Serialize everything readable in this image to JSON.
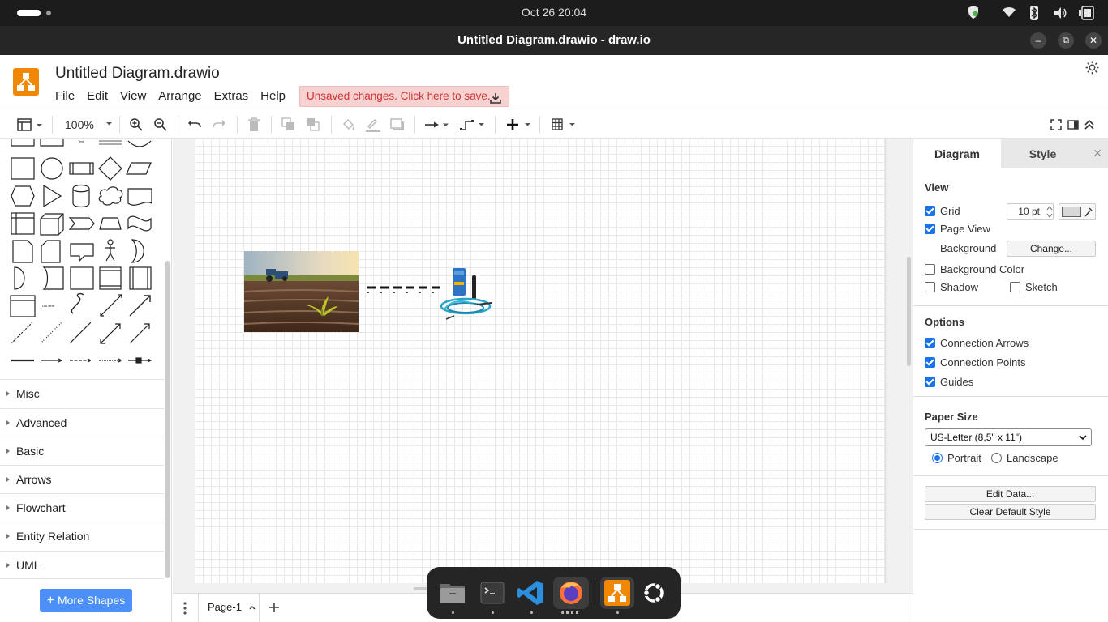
{
  "system": {
    "clock": "Oct 26  20:04"
  },
  "window": {
    "title": "Untitled Diagram.drawio - draw.io",
    "minimize": "–",
    "maximize": "⧉",
    "close": "✕"
  },
  "app": {
    "doc_title": "Untitled Diagram.drawio",
    "menu": [
      "File",
      "Edit",
      "View",
      "Arrange",
      "Extras",
      "Help"
    ],
    "unsaved_notice": "Unsaved changes. Click here to save."
  },
  "toolbar": {
    "zoom": "100%"
  },
  "sidebar": {
    "categories": [
      "Misc",
      "Advanced",
      "Basic",
      "Arrows",
      "Flowchart",
      "Entity Relation",
      "UML"
    ],
    "more_shapes": "More Shapes"
  },
  "page_tabs": {
    "current": "Page-1"
  },
  "format_panel": {
    "tabs": [
      "Diagram",
      "Style"
    ],
    "view": {
      "heading": "View",
      "grid_label": "Grid",
      "grid_checked": true,
      "grid_size": "10 pt",
      "page_view_label": "Page View",
      "page_view_checked": true,
      "background_label": "Background",
      "change_button": "Change...",
      "background_color_label": "Background Color",
      "shadow_label": "Shadow",
      "sketch_label": "Sketch"
    },
    "options": {
      "heading": "Options",
      "connection_arrows": "Connection Arrows",
      "connection_points": "Connection Points",
      "guides": "Guides"
    },
    "paper": {
      "heading": "Paper Size",
      "selected": "US-Letter (8,5\" x 11\")",
      "portrait": "Portrait",
      "landscape": "Landscape",
      "orientation": "Portrait"
    },
    "actions": {
      "edit_data": "Edit Data...",
      "clear_style": "Clear Default Style"
    }
  },
  "colors": {
    "accent": "#1a73e8",
    "drawio_orange": "#f08705",
    "unsaved_bg": "#f8d2d1",
    "unsaved_text": "#cc3333",
    "more_shapes_blue": "#4b8ff7"
  }
}
